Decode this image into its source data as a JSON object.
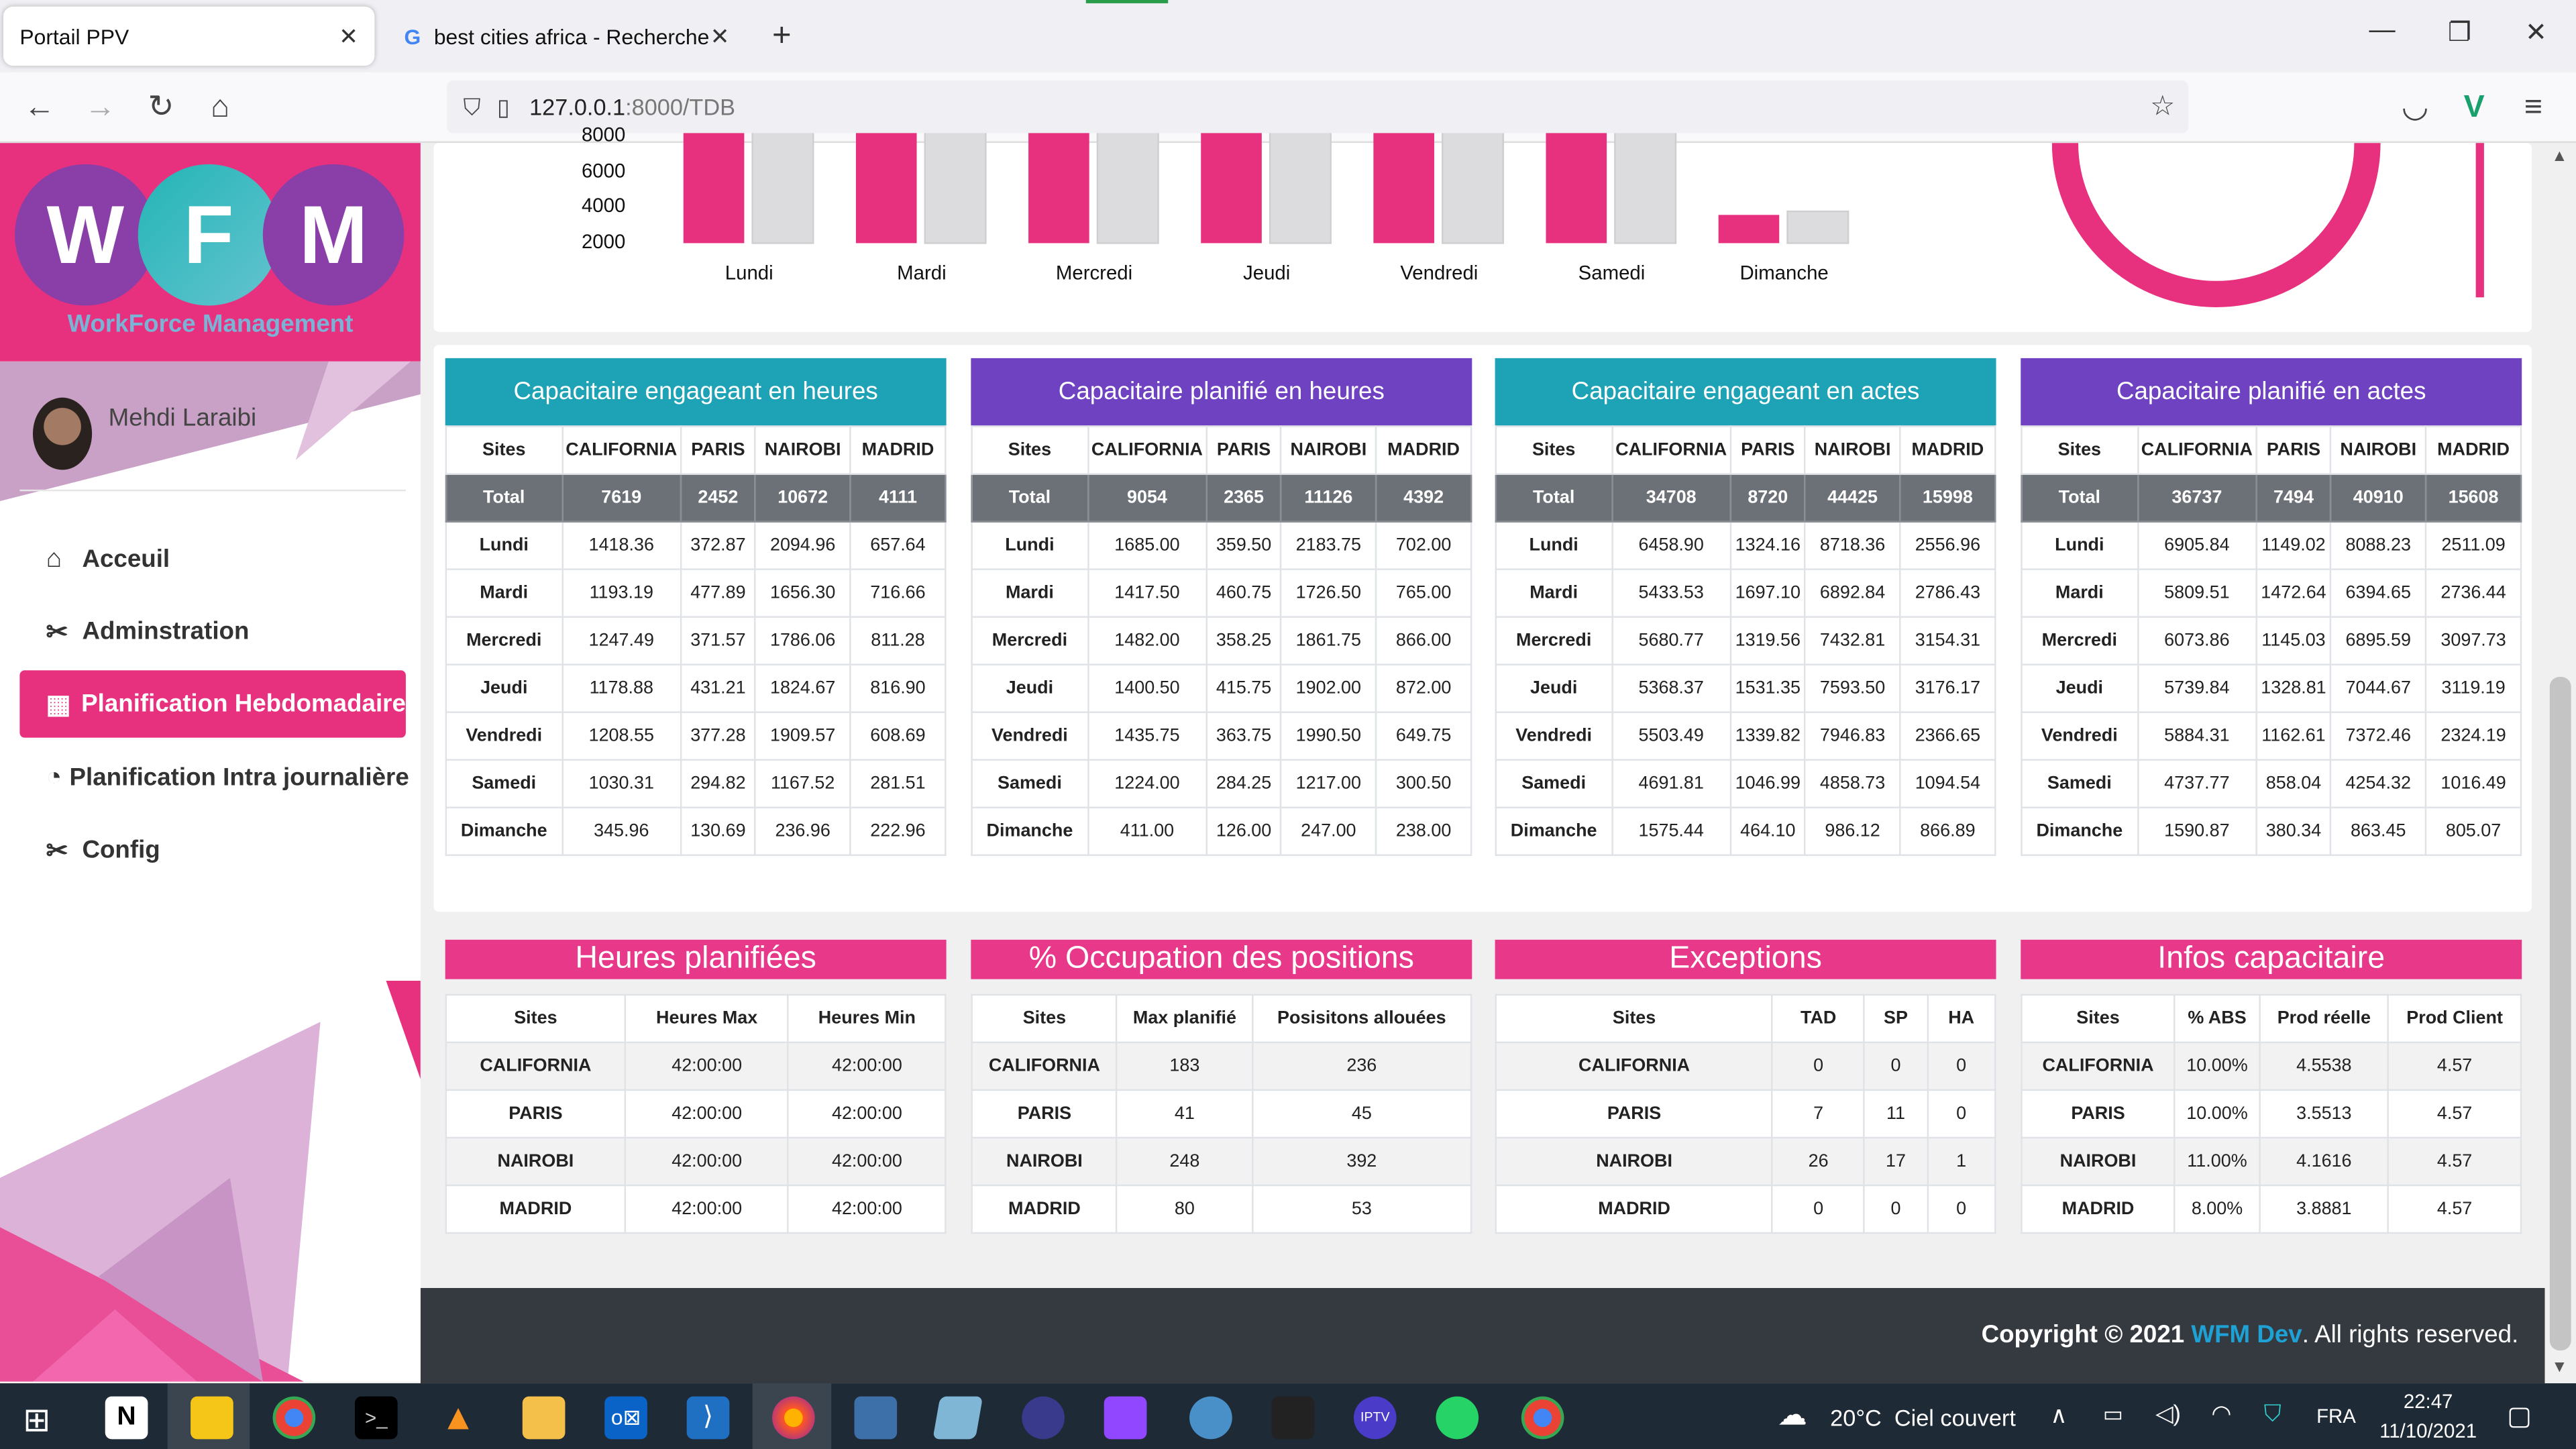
{
  "browser": {
    "tabs": [
      {
        "label": "Portail PPV"
      },
      {
        "label": "best cities africa - Recherche Go"
      }
    ],
    "url_host": "127.0.0.1",
    "url_path": ":8000/TDB"
  },
  "sidebar": {
    "logo_letters": [
      "W",
      "F",
      "M"
    ],
    "logo_subtitle": "WorkForce Management",
    "user_name": "Mehdi Laraibi",
    "menu": [
      {
        "label": "Acceuil",
        "icon": "home-icon"
      },
      {
        "label": "Adminstration",
        "icon": "tools-icon"
      },
      {
        "label": "Planification Hebdomadaire",
        "icon": "calendar-icon",
        "active": true
      },
      {
        "label": "Planification Intra journalière",
        "icon": "gauge-icon"
      },
      {
        "label": "Config",
        "icon": "tools-icon"
      }
    ]
  },
  "chart_data": {
    "type": "bar",
    "categories": [
      "Lundi",
      "Mardi",
      "Mercredi",
      "Jeudi",
      "Vendredi",
      "Samedi",
      "Dimanche"
    ],
    "yticks": [
      "8000",
      "6000",
      "4000",
      "2000"
    ],
    "ylim": [
      0,
      8000
    ],
    "series": [
      {
        "values": [
          10000,
          10000,
          10000,
          10000,
          10000,
          10000,
          1600
        ],
        "color": "#e8317e"
      },
      {
        "values": [
          10000,
          10000,
          10000,
          10000,
          10000,
          10000,
          1800
        ],
        "color": "#dcdcde"
      }
    ]
  },
  "tables_top": [
    {
      "title": "Capacitaire engageant en heures",
      "color": "#1ea2b6",
      "headers": [
        "Sites",
        "CALIFORNIA",
        "PARIS",
        "NAIROBI",
        "MADRID"
      ],
      "total": [
        "Total",
        "7619",
        "2452",
        "10672",
        "4111"
      ],
      "rows": [
        [
          "Lundi",
          "1418.36",
          "372.87",
          "2094.96",
          "657.64"
        ],
        [
          "Mardi",
          "1193.19",
          "477.89",
          "1656.30",
          "716.66"
        ],
        [
          "Mercredi",
          "1247.49",
          "371.57",
          "1786.06",
          "811.28"
        ],
        [
          "Jeudi",
          "1178.88",
          "431.21",
          "1824.67",
          "816.90"
        ],
        [
          "Vendredi",
          "1208.55",
          "377.28",
          "1909.57",
          "608.69"
        ],
        [
          "Samedi",
          "1030.31",
          "294.82",
          "1167.52",
          "281.51"
        ],
        [
          "Dimanche",
          "345.96",
          "130.69",
          "236.96",
          "222.96"
        ]
      ]
    },
    {
      "title": "Capacitaire planifié en heures",
      "color": "#6f42c1",
      "headers": [
        "Sites",
        "CALIFORNIA",
        "PARIS",
        "NAIROBI",
        "MADRID"
      ],
      "total": [
        "Total",
        "9054",
        "2365",
        "11126",
        "4392"
      ],
      "rows": [
        [
          "Lundi",
          "1685.00",
          "359.50",
          "2183.75",
          "702.00"
        ],
        [
          "Mardi",
          "1417.50",
          "460.75",
          "1726.50",
          "765.00"
        ],
        [
          "Mercredi",
          "1482.00",
          "358.25",
          "1861.75",
          "866.00"
        ],
        [
          "Jeudi",
          "1400.50",
          "415.75",
          "1902.00",
          "872.00"
        ],
        [
          "Vendredi",
          "1435.75",
          "363.75",
          "1990.50",
          "649.75"
        ],
        [
          "Samedi",
          "1224.00",
          "284.25",
          "1217.00",
          "300.50"
        ],
        [
          "Dimanche",
          "411.00",
          "126.00",
          "247.00",
          "238.00"
        ]
      ]
    },
    {
      "title": "Capacitaire engageant en actes",
      "color": "#1ea2b6",
      "headers": [
        "Sites",
        "CALIFORNIA",
        "PARIS",
        "NAIROBI",
        "MADRID"
      ],
      "total": [
        "Total",
        "34708",
        "8720",
        "44425",
        "15998"
      ],
      "rows": [
        [
          "Lundi",
          "6458.90",
          "1324.16",
          "8718.36",
          "2556.96"
        ],
        [
          "Mardi",
          "5433.53",
          "1697.10",
          "6892.84",
          "2786.43"
        ],
        [
          "Mercredi",
          "5680.77",
          "1319.56",
          "7432.81",
          "3154.31"
        ],
        [
          "Jeudi",
          "5368.37",
          "1531.35",
          "7593.50",
          "3176.17"
        ],
        [
          "Vendredi",
          "5503.49",
          "1339.82",
          "7946.83",
          "2366.65"
        ],
        [
          "Samedi",
          "4691.81",
          "1046.99",
          "4858.73",
          "1094.54"
        ],
        [
          "Dimanche",
          "1575.44",
          "464.10",
          "986.12",
          "866.89"
        ]
      ]
    },
    {
      "title": "Capacitaire planifié en actes",
      "color": "#6f42c1",
      "headers": [
        "Sites",
        "CALIFORNIA",
        "PARIS",
        "NAIROBI",
        "MADRID"
      ],
      "total": [
        "Total",
        "36737",
        "7494",
        "40910",
        "15608"
      ],
      "rows": [
        [
          "Lundi",
          "6905.84",
          "1149.02",
          "8088.23",
          "2511.09"
        ],
        [
          "Mardi",
          "5809.51",
          "1472.64",
          "6394.65",
          "2736.44"
        ],
        [
          "Mercredi",
          "6073.86",
          "1145.03",
          "6895.59",
          "3097.73"
        ],
        [
          "Jeudi",
          "5739.84",
          "1328.81",
          "7044.67",
          "3119.19"
        ],
        [
          "Vendredi",
          "5884.31",
          "1162.61",
          "7372.46",
          "2324.19"
        ],
        [
          "Samedi",
          "4737.77",
          "858.04",
          "4254.32",
          "1016.49"
        ],
        [
          "Dimanche",
          "1590.87",
          "380.34",
          "863.45",
          "805.07"
        ]
      ]
    }
  ],
  "tables_bottom": [
    {
      "title": "Heures planifiées",
      "headers": [
        "Sites",
        "Heures Max",
        "Heures Min"
      ],
      "rows": [
        [
          "CALIFORNIA",
          "42:00:00",
          "42:00:00"
        ],
        [
          "PARIS",
          "42:00:00",
          "42:00:00"
        ],
        [
          "NAIROBI",
          "42:00:00",
          "42:00:00"
        ],
        [
          "MADRID",
          "42:00:00",
          "42:00:00"
        ]
      ]
    },
    {
      "title": "% Occupation des positions",
      "headers": [
        "Sites",
        "Max planifié",
        "Posisitons allouées"
      ],
      "rows": [
        [
          "CALIFORNIA",
          "183",
          "236"
        ],
        [
          "PARIS",
          "41",
          "45"
        ],
        [
          "NAIROBI",
          "248",
          "392"
        ],
        [
          "MADRID",
          "80",
          "53"
        ]
      ]
    },
    {
      "title": "Exceptions",
      "headers": [
        "Sites",
        "TAD",
        "SP",
        "HA"
      ],
      "rows": [
        [
          "CALIFORNIA",
          "0",
          "0",
          "0"
        ],
        [
          "PARIS",
          "7",
          "11",
          "0"
        ],
        [
          "NAIROBI",
          "26",
          "17",
          "1"
        ],
        [
          "MADRID",
          "0",
          "0",
          "0"
        ]
      ]
    },
    {
      "title": "Infos capacitaire",
      "headers": [
        "Sites",
        "% ABS",
        "Prod réelle",
        "Prod Client"
      ],
      "rows": [
        [
          "CALIFORNIA",
          "10.00%",
          "4.5538",
          "4.57"
        ],
        [
          "PARIS",
          "10.00%",
          "3.5513",
          "4.57"
        ],
        [
          "NAIROBI",
          "11.00%",
          "4.1616",
          "4.57"
        ],
        [
          "MADRID",
          "8.00%",
          "3.8881",
          "4.57"
        ]
      ]
    }
  ],
  "footer": {
    "prefix": "Copyright © 2021 ",
    "brand": "WFM Dev",
    "suffix": ". All rights reserved."
  },
  "taskbar": {
    "weather": "20°C  Ciel couvert",
    "lang": "FRA",
    "time": "22:47",
    "date": "11/10/2021"
  }
}
